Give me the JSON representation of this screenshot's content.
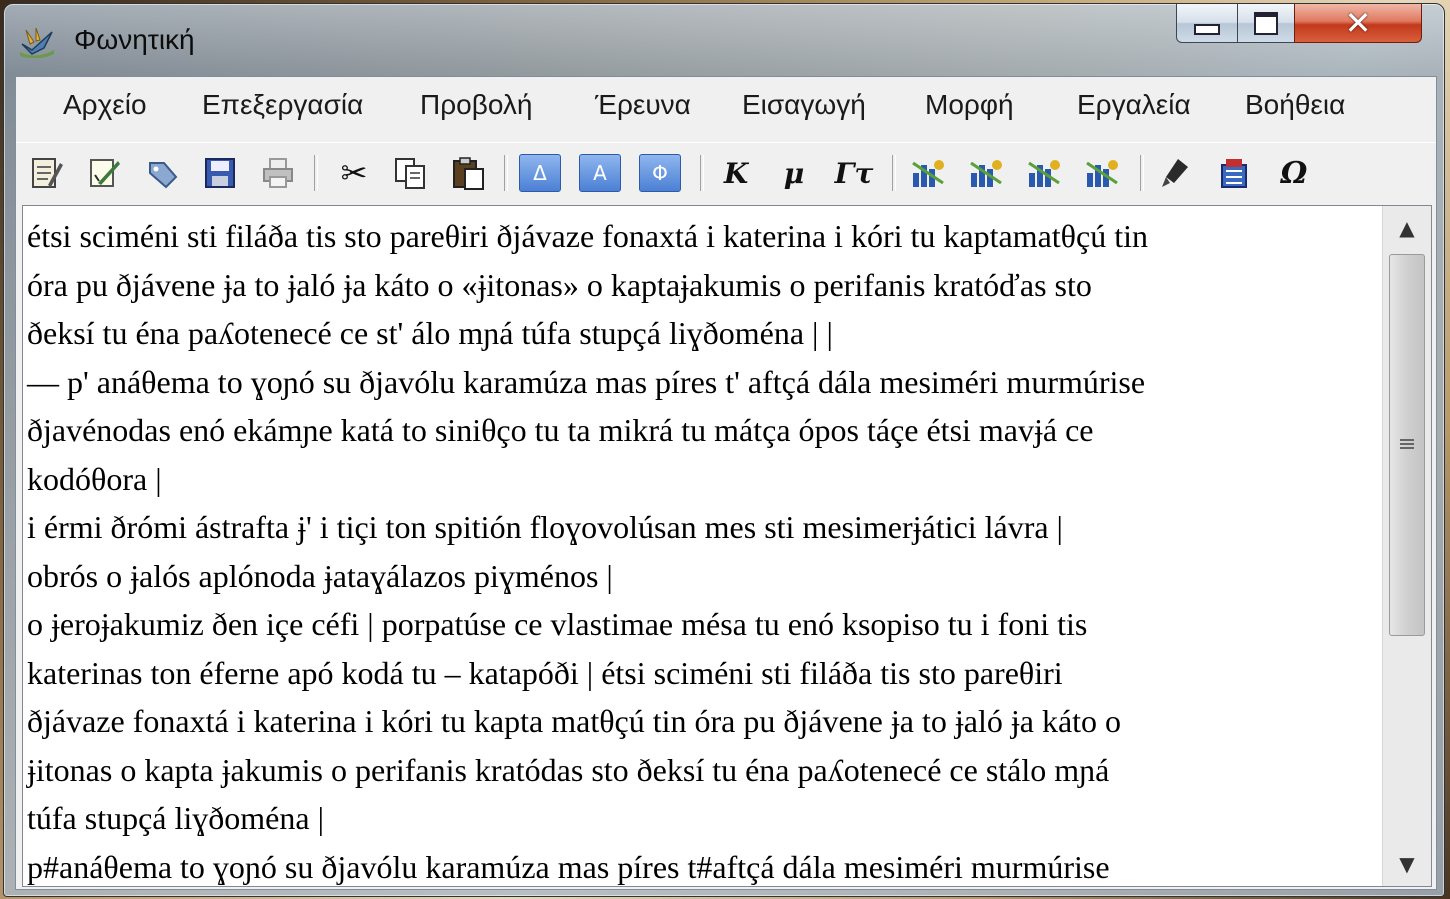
{
  "window": {
    "title": "Φωνητική"
  },
  "menu": [
    "Αρχείο",
    "Επεξεργασία",
    "Προβολή",
    "Έρευνα",
    "Εισαγωγή",
    "Μορφή",
    "Εργαλεία",
    "Βοήθεια"
  ],
  "toolbar": {
    "blue_a1": "Δ",
    "blue_a2": "Α",
    "blue_phi": "Φ",
    "format_k": "Κ",
    "format_mu": "μ",
    "format_gt": "Γτ",
    "omega": "Ω"
  },
  "editor": {
    "lines": [
      "étsi sciméni sti filáða tis sto pareθiri ðjávaze fonaxtá i katerina i kóri tu kaptamatθçú tin",
      "óra pu ðjávene ɉa to ɉaló ɉa káto o «ɉitonas» o kaptaɉakumis o perifanis kratóďas sto",
      "ðeksí tu éna paʎotenecé ce st' álo mɲá túfa stupçá liɣðoména | |",
      "— p' anáθema to ɣoɲó su ðjavólu karamúza mas píres t' aftçá dála mesiméri murmúrise",
      "ðjavénodas enó ekámɲe katá to siniθço tu ta mikrá tu mátça ópos táçe étsi mavɉá ce",
      "kodóθora |",
      "i érmi ðrómi ástrafta ɉ' i tiçi ton spitión floɣovolúsan mes sti mesimerɉátici lávra |",
      "obrós o ɉalós aplónoda ɉataɣálazos piɣménos |",
      "o ɉeroɉakumiz ðen içe céfi | porpatúse ce vlastimae mésa tu enó ksopiso tu i foni tis",
      "katerinas ton éferne apó kodá tu – katapóði | étsi sciméni sti filáða tis sto pareθiri",
      "ðjávaze fonaxtá i katerina i kóri tu kapta matθçú tin óra pu ðjávene ɉa to ɉaló ɉa káto o",
      "ɉitonas o kapta ɉakumis o perifanis kratódas sto ðeksí tu éna paʎotenecé ce stálo mɲá",
      "túfa stupçá liɣðoména |",
      "p#anáθema to ɣoɲó su ðjavólu karamúza mas píres t#aftçá dála mesiméri murmúrise"
    ]
  }
}
